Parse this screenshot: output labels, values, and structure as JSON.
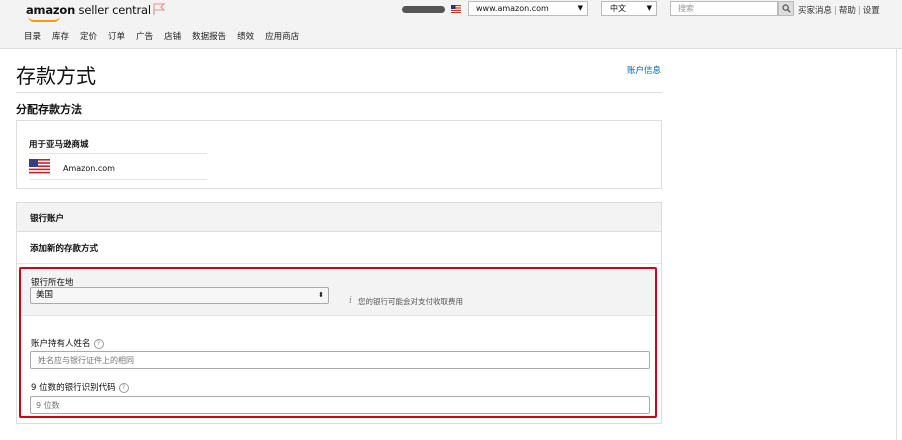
{
  "header": {
    "logo_bold": "amazon",
    "logo_text": " seller central",
    "marketplace_value": "www.amazon.com",
    "language_value": "中文",
    "search_placeholder": "搜索",
    "links": [
      "买家消息",
      "帮助",
      "设置"
    ],
    "link_separator": "|"
  },
  "nav": [
    "目录",
    "库存",
    "定价",
    "订单",
    "广告",
    "店铺",
    "数据报告",
    "绩效",
    "应用商店"
  ],
  "page": {
    "title": "存款方式",
    "account_info_link": "账户信息",
    "section_title": "分配存款方法"
  },
  "marketplace_panel": {
    "label": "用于亚马逊商城",
    "marketplace": "Amazon.com"
  },
  "bank_panel": {
    "header": "银行账户",
    "add_new": "添加新的存款方式",
    "location_label": "银行所在地",
    "country_value": "美国",
    "info_icon_glyph": "i",
    "info_text": "您的银行可能会对支付收取费用",
    "holder_label": "账户持有人姓名",
    "holder_placeholder": "姓名应与银行证件上的相同",
    "routing_label": "9 位数的银行识别代码",
    "routing_placeholder": "9 位数",
    "help_glyph": "?"
  },
  "colors": {
    "highlight_border": "#d0021b",
    "link": "#0066c0",
    "logo_accent": "#ff9900"
  },
  "icons": [
    "flag-icon",
    "us-flag-icon",
    "search-icon",
    "select-caret-icon",
    "updown-caret-icon",
    "info-icon",
    "help-icon"
  ]
}
